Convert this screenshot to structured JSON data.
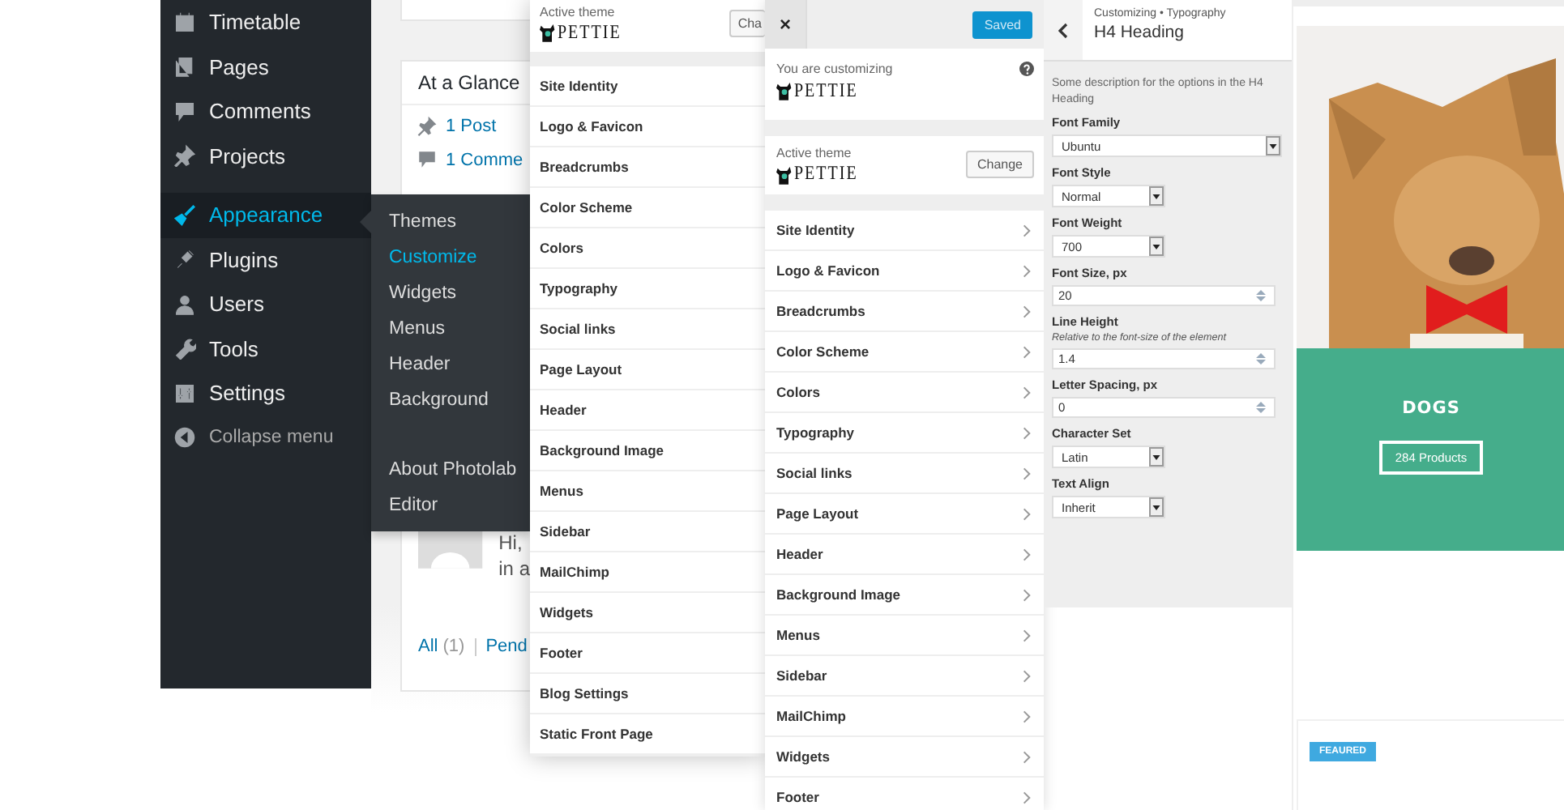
{
  "admin_menu": {
    "groups": [
      [
        {
          "label": "Timetable",
          "selected": false
        },
        {
          "label": "Pages",
          "selected": false
        },
        {
          "label": "Comments",
          "selected": false
        },
        {
          "label": "Projects",
          "selected": false
        }
      ],
      [
        {
          "label": "Appearance",
          "selected": true
        },
        {
          "label": "Plugins",
          "selected": false
        },
        {
          "label": "Users",
          "selected": false
        },
        {
          "label": "Tools",
          "selected": false
        },
        {
          "label": "Settings",
          "selected": false
        }
      ]
    ],
    "collapse": "Collapse menu"
  },
  "submenu": {
    "groups": [
      [
        {
          "label": "Themes",
          "selected": false
        },
        {
          "label": "Customize",
          "selected": true
        },
        {
          "label": "Widgets",
          "selected": false
        },
        {
          "label": "Menus",
          "selected": false
        },
        {
          "label": "Header",
          "selected": false
        },
        {
          "label": "Background",
          "selected": false
        }
      ],
      [
        {
          "label": "About Photolab",
          "selected": false
        },
        {
          "label": "Editor",
          "selected": false
        }
      ]
    ]
  },
  "dashboard": {
    "widget_title": "At a Glance",
    "stats": [
      "1 Post",
      "1 Comme"
    ],
    "comment_lines": [
      "Hi,",
      "in a"
    ],
    "filter_links": [
      {
        "label": "All",
        "count": "(1)"
      },
      {
        "label": "Pend"
      }
    ]
  },
  "customizer_back": {
    "active_theme_label": "Active theme",
    "theme_logo": "PETTIE",
    "change_button": "Cha",
    "sections": [
      "Site Identity",
      "Logo & Favicon",
      "Breadcrumbs",
      "Color Scheme",
      "Colors",
      "Typography",
      "Social links",
      "Page Layout",
      "Header",
      "Background Image",
      "Menus",
      "Sidebar",
      "MailChimp",
      "Widgets",
      "Footer",
      "Blog Settings",
      "Static Front Page"
    ]
  },
  "customizer": {
    "close": "×",
    "save_button": "Saved",
    "customizing_label": "You are customizing",
    "site_logo": "PETTIE",
    "active_theme_label": "Active theme",
    "theme_logo": "PETTIE",
    "change_button": "Change",
    "sections": [
      "Site Identity",
      "Logo & Favicon",
      "Breadcrumbs",
      "Color Scheme",
      "Colors",
      "Typography",
      "Social links",
      "Page Layout",
      "Header",
      "Background Image",
      "Menus",
      "Sidebar",
      "MailChimp",
      "Widgets",
      "Footer"
    ]
  },
  "typography_panel": {
    "breadcrumb": "Customizing • Typography",
    "title": "H4 Heading",
    "description": "Some description for the options in the H4 Heading",
    "fields": [
      {
        "kind": "select",
        "label": "Font Family",
        "value": "Ubuntu",
        "wide": true
      },
      {
        "kind": "select",
        "label": "Font Style",
        "value": "Normal",
        "wide": false
      },
      {
        "kind": "select",
        "label": "Font Weight",
        "value": "700",
        "wide": false
      },
      {
        "kind": "number",
        "label": "Font Size, px",
        "value": "20"
      },
      {
        "kind": "number",
        "label": "Line Height",
        "hint": "Relative to the font-size of the element",
        "value": "1.4"
      },
      {
        "kind": "number",
        "label": "Letter Spacing, px",
        "value": "0"
      },
      {
        "kind": "select",
        "label": "Character Set",
        "value": "Latin",
        "wide": false
      },
      {
        "kind": "select",
        "label": "Text Align",
        "value": "Inherit",
        "wide": false
      }
    ]
  },
  "preview": {
    "category": "DOGS",
    "products_button": "284 Products",
    "badge": "FEAURED"
  }
}
